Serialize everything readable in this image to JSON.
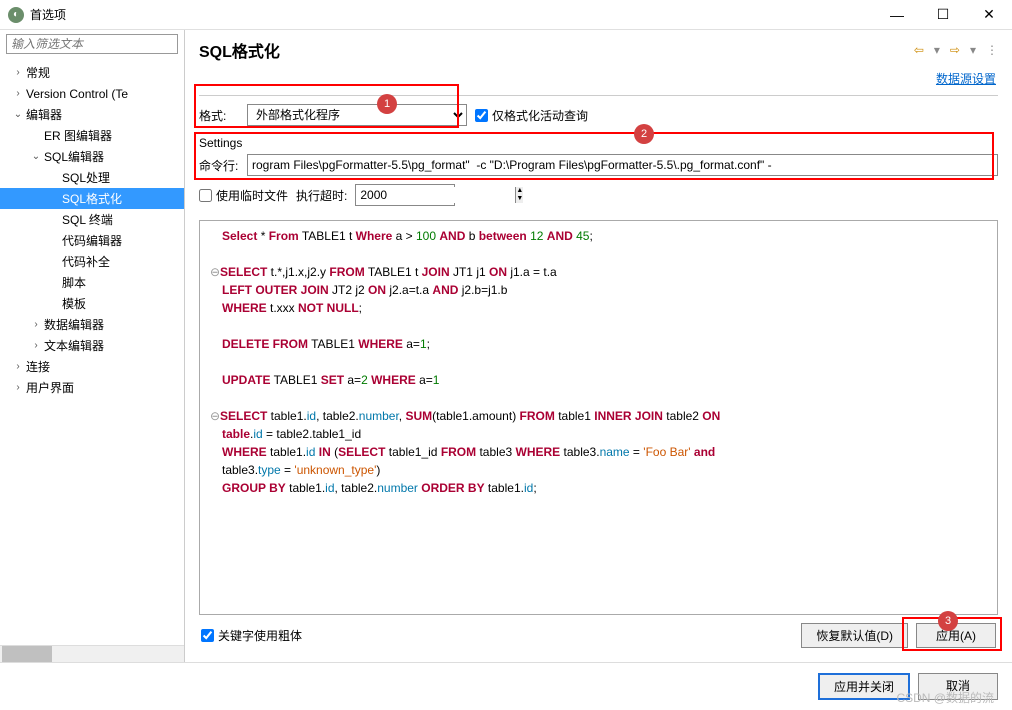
{
  "window": {
    "title": "首选项"
  },
  "window_buttons": {
    "min": "—",
    "max": "☐",
    "close": "✕"
  },
  "sidebar": {
    "filter_placeholder": "输入筛选文本",
    "items": [
      {
        "label": "常规",
        "expandable": true,
        "expanded": false,
        "indent": 0
      },
      {
        "label": "Version Control (Te",
        "expandable": true,
        "expanded": false,
        "indent": 0
      },
      {
        "label": "编辑器",
        "expandable": true,
        "expanded": true,
        "indent": 0
      },
      {
        "label": "ER 图编辑器",
        "expandable": false,
        "indent": 1
      },
      {
        "label": "SQL编辑器",
        "expandable": true,
        "expanded": true,
        "indent": 1
      },
      {
        "label": "SQL处理",
        "expandable": false,
        "indent": 2
      },
      {
        "label": "SQL格式化",
        "expandable": false,
        "indent": 2,
        "selected": true
      },
      {
        "label": "SQL 终端",
        "expandable": false,
        "indent": 2
      },
      {
        "label": "代码编辑器",
        "expandable": false,
        "indent": 2
      },
      {
        "label": "代码补全",
        "expandable": false,
        "indent": 2
      },
      {
        "label": "脚本",
        "expandable": false,
        "indent": 2
      },
      {
        "label": "模板",
        "expandable": false,
        "indent": 2
      },
      {
        "label": "数据编辑器",
        "expandable": true,
        "expanded": false,
        "indent": 1
      },
      {
        "label": "文本编辑器",
        "expandable": true,
        "expanded": false,
        "indent": 1
      },
      {
        "label": "连接",
        "expandable": true,
        "expanded": false,
        "indent": 0
      },
      {
        "label": "用户界面",
        "expandable": true,
        "expanded": false,
        "indent": 0
      }
    ]
  },
  "content": {
    "title": "SQL格式化",
    "datasource_link": "数据源设置",
    "format_label": "格式:",
    "format_value": "外部格式化程序",
    "only_active_query": "仅格式化活动查询",
    "settings_label": "Settings",
    "cmd_label": "命令行:",
    "cmd_value": "rogram Files\\pgFormatter-5.5\\pg_format\"  -c \"D:\\Program Files\\pgFormatter-5.5\\.pg_format.conf\" -",
    "use_temp_file": "使用临时文件",
    "exec_timeout_label": "执行超时:",
    "exec_timeout_value": "2000",
    "bold_keywords": "关键字使用粗体",
    "restore_defaults": "恢复默认值(D)",
    "apply": "应用(A)"
  },
  "badges": {
    "b1": "1",
    "b2": "2",
    "b3": "3"
  },
  "footer": {
    "apply_close": "应用并关闭",
    "cancel": "取消"
  },
  "watermark": "CSDN @数据的流",
  "code_tokens": [
    [
      {
        "t": "Select",
        "c": "kw"
      },
      " * ",
      {
        "t": "From",
        "c": "kw"
      },
      " TABLE1 t ",
      {
        "t": "Where",
        "c": "kw"
      },
      " a > ",
      {
        "t": "100",
        "c": "num"
      },
      " ",
      {
        "t": "AND",
        "c": "kw"
      },
      " b ",
      {
        "t": "between",
        "c": "kw"
      },
      " ",
      {
        "t": "12",
        "c": "num"
      },
      " ",
      {
        "t": "AND",
        "c": "kw"
      },
      " ",
      {
        "t": "45",
        "c": "num"
      },
      ";"
    ],
    [],
    [
      {
        "g": "⊖"
      },
      {
        "t": "SELECT",
        "c": "kw"
      },
      " t.*,j1.x,j2.y ",
      {
        "t": "FROM",
        "c": "kw"
      },
      " TABLE1 t ",
      {
        "t": "JOIN",
        "c": "kw"
      },
      " JT1 j1 ",
      {
        "t": "ON",
        "c": "kw"
      },
      " j1.a = t.a"
    ],
    [
      {
        "t": "LEFT OUTER JOIN",
        "c": "kw"
      },
      " JT2 j2 ",
      {
        "t": "ON",
        "c": "kw"
      },
      " j2.a=t.a ",
      {
        "t": "AND",
        "c": "kw"
      },
      " j2.b=j1.b"
    ],
    [
      {
        "t": "WHERE",
        "c": "kw"
      },
      " t.xxx ",
      {
        "t": "NOT NULL",
        "c": "kw"
      },
      ";"
    ],
    [],
    [
      {
        "t": "DELETE FROM",
        "c": "kw"
      },
      " TABLE1 ",
      {
        "t": "WHERE",
        "c": "kw"
      },
      " a=",
      {
        "t": "1",
        "c": "num"
      },
      ";"
    ],
    [],
    [
      {
        "t": "UPDATE",
        "c": "kw"
      },
      " TABLE1 ",
      {
        "t": "SET",
        "c": "kw"
      },
      " a=",
      {
        "t": "2",
        "c": "num"
      },
      " ",
      {
        "t": "WHERE",
        "c": "kw"
      },
      " a=",
      {
        "t": "1",
        "c": "num"
      }
    ],
    [],
    [
      {
        "g": "⊖"
      },
      {
        "t": "SELECT",
        "c": "kw"
      },
      " table1.",
      {
        "t": "id",
        "c": "col"
      },
      ", table2.",
      {
        "t": "number",
        "c": "col"
      },
      ", ",
      {
        "t": "SUM",
        "c": "kw"
      },
      "(table1.amount) ",
      {
        "t": "FROM",
        "c": "kw"
      },
      " table1 ",
      {
        "t": "INNER JOIN",
        "c": "kw"
      },
      " table2 ",
      {
        "t": "ON",
        "c": "kw"
      }
    ],
    [
      {
        "t": "table",
        "c": "kw"
      },
      ".",
      {
        "t": "id",
        "c": "col"
      },
      " = table2.table1_id"
    ],
    [
      {
        "t": "WHERE",
        "c": "kw"
      },
      " table1.",
      {
        "t": "id",
        "c": "col"
      },
      " ",
      {
        "t": "IN",
        "c": "kw"
      },
      " (",
      {
        "t": "SELECT",
        "c": "kw"
      },
      " table1_id ",
      {
        "t": "FROM",
        "c": "kw"
      },
      " table3 ",
      {
        "t": "WHERE",
        "c": "kw"
      },
      " table3.",
      {
        "t": "name",
        "c": "col"
      },
      " = ",
      {
        "t": "'Foo Bar'",
        "c": "str"
      },
      " ",
      {
        "t": "and",
        "c": "kw"
      }
    ],
    [
      "table3.",
      {
        "t": "type",
        "c": "col"
      },
      " = ",
      {
        "t": "'unknown_type'",
        "c": "str"
      },
      ")"
    ],
    [
      {
        "t": "GROUP BY",
        "c": "kw"
      },
      " table1.",
      {
        "t": "id",
        "c": "col"
      },
      ", table2.",
      {
        "t": "number",
        "c": "col"
      },
      " ",
      {
        "t": "ORDER BY",
        "c": "kw"
      },
      " table1.",
      {
        "t": "id",
        "c": "col"
      },
      ";"
    ]
  ]
}
